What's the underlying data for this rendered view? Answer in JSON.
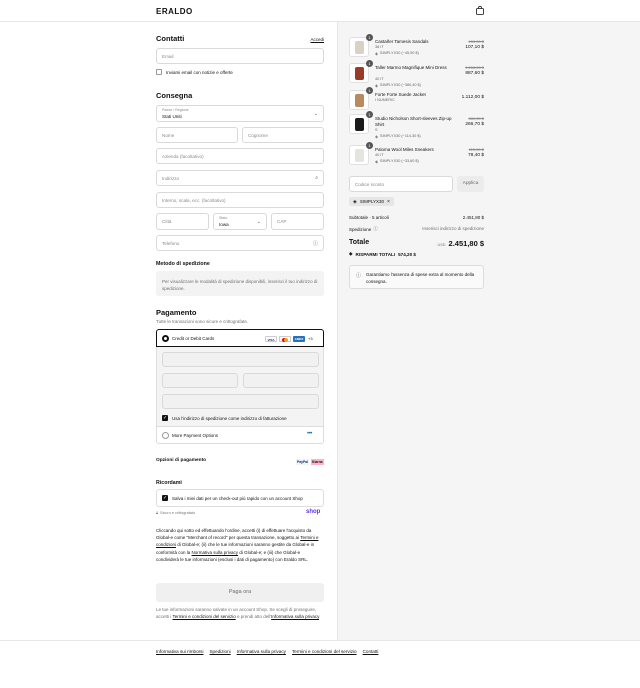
{
  "header": {
    "logo": "ERALDO",
    "bag_icon": "shopping-bag-icon"
  },
  "contacts": {
    "title": "Contatti",
    "login_link": "Accedi",
    "email_placeholder": "Email",
    "newsletter_label": "Inviami email con notizie e offerte"
  },
  "shipping": {
    "title": "Consegna",
    "country_label": "Paese / Regione",
    "country_value": "Stati Uniti",
    "first_name_placeholder": "Nome",
    "last_name_placeholder": "Cognome",
    "company_placeholder": "Azienda (facoltativo)",
    "address_placeholder": "Indirizzo",
    "apartment_placeholder": "Interno, scala, ecc. (facoltativo)",
    "city_placeholder": "Città",
    "state_label": "Stato",
    "state_value": "Iowa",
    "zip_placeholder": "CAP",
    "phone_placeholder": "Telefono"
  },
  "shipping_method": {
    "title": "Metodo di spedizione",
    "info": "Per visualizzare le modalità di spedizione disponibili, inserisci il tuo indirizzo di spedizione."
  },
  "payment": {
    "title": "Pagamento",
    "subtitle": "Tutte le transazioni sono sicure e crittografate.",
    "card_option": "Credit or Debit Cards",
    "card_brands": [
      "VISA",
      "MC",
      "AMEX"
    ],
    "more_cards": "+3",
    "same_address_label": "Usa l'indirizzo di spedizione come indirizzo di fatturazione",
    "more_options": "More Payment Options",
    "options_title": "Opzioni di pagamento",
    "options_brands": [
      "PayPal",
      "Klarna"
    ]
  },
  "remember": {
    "title": "Ricordami",
    "save_label": "Salva i miei dati per un check-out più rapido con un account Shop",
    "secure_note": "Sicuro e crittografato",
    "shop_logo": "shop"
  },
  "legal": {
    "text_1": "Cliccando qui sotto ed effettuando l'ordine, accetti (i) di effettuare l'acquisto da Global-e come \"Merchant of record\" per questa transazione, soggetto ai",
    "link_terms": "Termini e condizioni",
    "text_2": "di Global-e; (ii) che le tue informazioni saranno gestite da Global-e in conformità con la",
    "link_privacy": "Normativa sulla privacy",
    "text_3": "di Global-e; e (iii) che Global-e condividerà le tue informazioni (esclusi i dati di pagamento) con Eraldo SRL."
  },
  "pay_button": "Paga ora",
  "shop_notice": {
    "text_1": "Le tue informazioni saranno salvate in un account Shop. Se scegli di proseguire, accetti i",
    "link_terms": "Termini e condizioni del servizio",
    "text_2": "e prendi atto dell'",
    "link_privacy": "Informativa sulla privacy",
    "text_3": "."
  },
  "footer": {
    "links": [
      "Informativa sui rimborsi",
      "Spedizioni",
      "Informativa sulla privacy",
      "Termini e condizioni del servizio",
      "Contatti"
    ]
  },
  "summary": {
    "items": [
      {
        "qty": "1",
        "name": "Castañer Tamesis Sandals",
        "variant": "38 IT",
        "discount": "SIMPLYX30 (−45,90 $)",
        "old_price": "153,00 $",
        "price": "107,10 $",
        "color": "#d9d2c4"
      },
      {
        "qty": "1",
        "name": "Taller Marmo Magnifique Mini Dress",
        "variant": "40 IT",
        "discount": "SIMPLYX30 (−380,40 $)",
        "old_price": "1.268,00 $",
        "price": "887,60 $",
        "color": "#9a3b2a"
      },
      {
        "qty": "1",
        "name": "Forte Forte Suede Jacket",
        "variant": "I NUMERIC",
        "discount": "",
        "old_price": "",
        "price": "1.112,00 $",
        "color": "#b98a5e"
      },
      {
        "qty": "1",
        "name": "Studio Nicholson Short-sleeves Zip-up Shirt",
        "variant": "S",
        "discount": "SIMPLYX30 (−114,30 $)",
        "old_price": "381,00 $",
        "price": "266,70 $",
        "color": "#1b1b1b"
      },
      {
        "qty": "1",
        "name": "Paloma Wool Miles Sneakers",
        "variant": "40 IT",
        "discount": "SIMPLYX30 (−33,60 $)",
        "old_price": "112,00 $",
        "price": "78,40 $",
        "color": "#e4e4e0"
      }
    ],
    "discount_placeholder": "Codice sconto",
    "apply_button": "Applica",
    "applied_code": "SIMPLYX30",
    "subtotal_label": "Subtotale · 5 articoli",
    "subtotal_value": "2.451,80 $",
    "shipping_label": "Spedizione",
    "shipping_value": "Inserisci indirizzo di spedizione",
    "total_label": "Totale",
    "currency": "USD",
    "total_value": "2.451,80 $",
    "savings_label": "RISPARMI TOTALI",
    "savings_value": "574,20 $",
    "guarantee": "Garantiamo l'assenza di spese extra al momento della consegna."
  }
}
